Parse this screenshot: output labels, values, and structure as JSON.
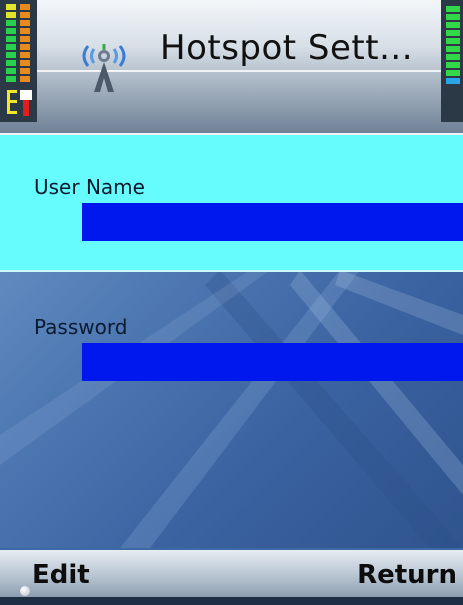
{
  "header": {
    "title": "Hotspot Sett...",
    "app_icon": "wifi-antenna-icon",
    "signal_icon": "signal-strength-icon",
    "battery_icon": "battery-icon"
  },
  "form": {
    "user_name_label": "User Name",
    "user_name_value": "",
    "password_label": "Password",
    "password_value": ""
  },
  "softkeys": {
    "left": "Edit",
    "right": "Return"
  },
  "colors": {
    "focused_field_bg": "#66fbfc",
    "input_bg": "#0018ee"
  }
}
